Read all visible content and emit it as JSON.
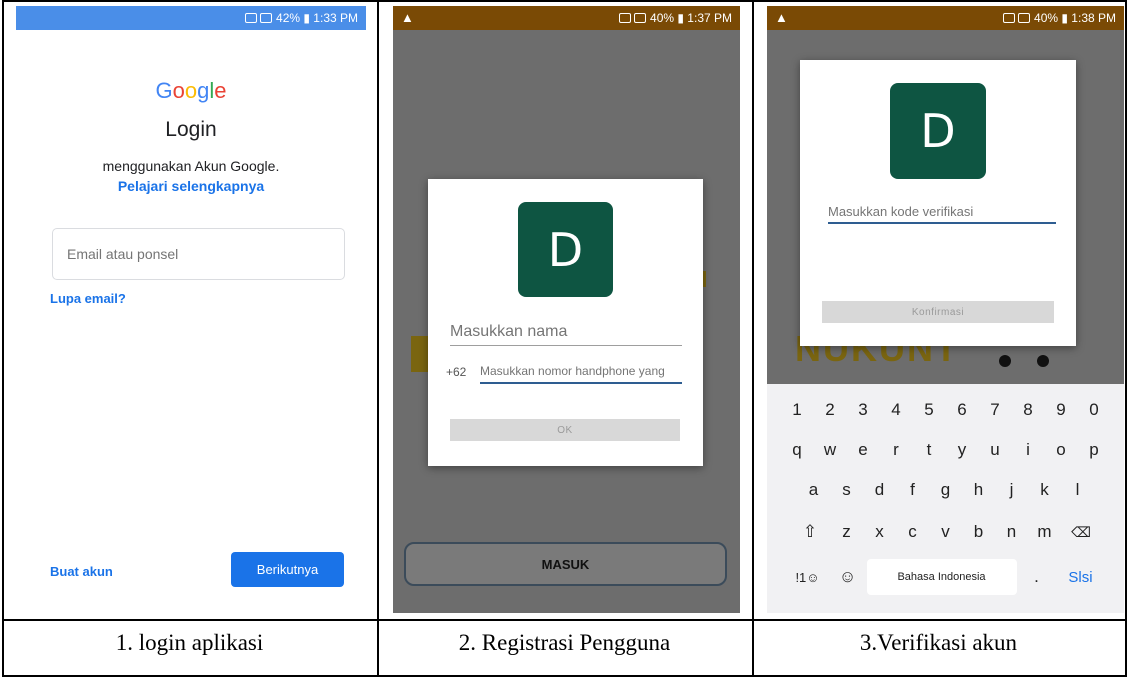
{
  "panels": [
    {
      "status": {
        "text": "42% ▮ 1:33 PM"
      },
      "google_logo": "Google",
      "title": "Login",
      "subtitle": "menggunakan Akun Google.",
      "learn_more": "Pelajari selengkapnya",
      "email_placeholder": "Email atau ponsel",
      "forgot_email": "Lupa email?",
      "create_account": "Buat akun",
      "next_button": "Berikutnya",
      "caption": "1. login aplikasi"
    },
    {
      "status": {
        "warn": "▲",
        "text": "40% ▮ 1:37 PM"
      },
      "avatar_letter": "D",
      "name_placeholder": "Masukkan nama",
      "country_code": "+62",
      "phone_placeholder": "Masukkan nomor handphone yang",
      "ok_button": "OK",
      "masuk_button": "MASUK",
      "caption": "2. Registrasi Pengguna"
    },
    {
      "status": {
        "warn": "▲",
        "text": "40% ▮ 1:38 PM"
      },
      "avatar_letter": "D",
      "code_placeholder": "Masukkan kode verifikasi",
      "confirm_button": "Konfirmasi",
      "background_text": "NUKUNT",
      "keyboard": {
        "row1": [
          "1",
          "2",
          "3",
          "4",
          "5",
          "6",
          "7",
          "8",
          "9",
          "0"
        ],
        "row2": [
          "q",
          "w",
          "e",
          "r",
          "t",
          "y",
          "u",
          "i",
          "o",
          "p"
        ],
        "row3": [
          "a",
          "s",
          "d",
          "f",
          "g",
          "h",
          "j",
          "k",
          "l"
        ],
        "row4_shift": "⇧",
        "row4": [
          "z",
          "x",
          "c",
          "v",
          "b",
          "n",
          "m"
        ],
        "row4_backspace": "⌫",
        "symbols_key": "!1☺",
        "emoji_key": "☺",
        "space_label": "Bahasa Indonesia",
        "period_key": ".",
        "enter_key": "Slsi"
      },
      "caption": "3.Verifikasi akun"
    }
  ],
  "colors": {
    "google_blue": "#1a73e8",
    "avatar_green": "#0e5542",
    "status_brown": "#7a4a05",
    "status_blue": "#4a8ee8"
  }
}
